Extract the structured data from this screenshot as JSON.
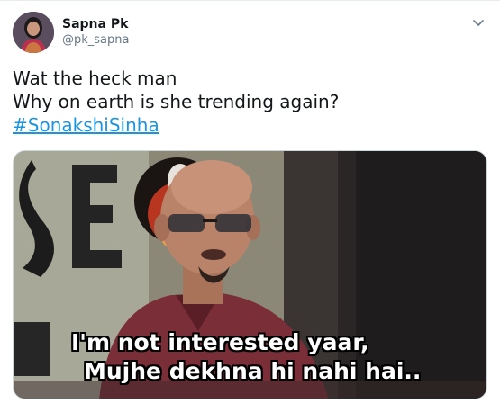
{
  "tweet": {
    "user": {
      "name": "Sapna Pk",
      "handle": "@pk_sapna"
    },
    "text_lines": [
      "Wat the heck man",
      "Why on earth is she trending again?"
    ],
    "hashtag": "#SonakshiSinha",
    "media": {
      "caption_line1": "I'm not interested yaar,",
      "caption_line2": "Mujhe dekhna hi nahi hai.."
    },
    "icons": {
      "menu": "chevron-down-icon",
      "avatar": "avatar"
    },
    "colors": {
      "link": "#1b95e0",
      "secondary_text": "#657786",
      "primary_text": "#14171a"
    }
  }
}
